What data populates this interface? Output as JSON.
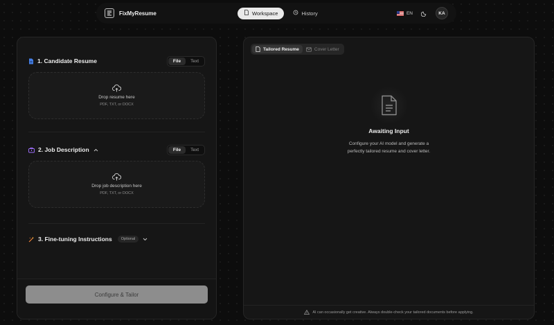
{
  "brand": {
    "name": "FixMyResume"
  },
  "nav": {
    "workspace_label": "Workspace",
    "history_label": "History"
  },
  "tools": {
    "lang": "EN",
    "avatar": "KA"
  },
  "sections": [
    {
      "title": "1. Candidate Resume",
      "icon": "document-icon",
      "color": "#4a8cff",
      "tab_file": "File",
      "tab_text": "Text",
      "drop_main": "Drop resume here",
      "drop_sub": "PDF, TXT, or DOCX"
    },
    {
      "title": "2. Job Description",
      "icon": "briefcase-icon",
      "color": "#a070ff",
      "tab_file": "File",
      "tab_text": "Text",
      "drop_main": "Drop job description here",
      "drop_sub": "PDF, TXT, or DOCX"
    },
    {
      "title": "3. Fine-tuning Instructions",
      "icon": "magic-wand-icon",
      "color": "#ff8a3d",
      "badge": "Optional"
    }
  ],
  "cta": {
    "label": "Configure & Tailor"
  },
  "output": {
    "tab_resume": "Tailored Resume",
    "tab_cover": "Cover Letter",
    "empty_title": "Awaiting Input",
    "empty_desc": "Configure your AI model and generate a perfectly tailored resume and cover letter.",
    "footer": "AI can occasionally get creative. Always double-check your tailored documents before applying."
  }
}
